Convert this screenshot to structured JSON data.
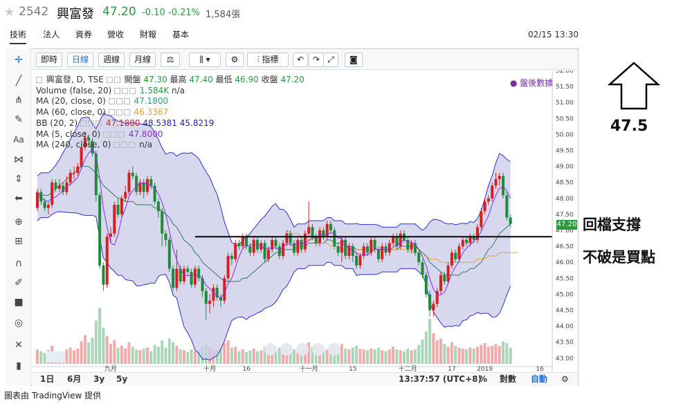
{
  "header": {
    "code": "2542",
    "name": "興富發",
    "price": "47.20",
    "change": "-0.10",
    "change_pct": "-0.21%",
    "volume": "1,584張",
    "datetime": "02/15 13:30"
  },
  "tabs": [
    {
      "label": "技術"
    },
    {
      "label": "法人"
    },
    {
      "label": "資券"
    },
    {
      "label": "營收"
    },
    {
      "label": "財報"
    },
    {
      "label": "基本"
    }
  ],
  "toolbar": {
    "intraday": "即時",
    "daily": "日線",
    "weekly": "週線",
    "monthly": "月線",
    "indicators": "指標"
  },
  "legend": {
    "main_title": "興富發, D, TSE",
    "open_label": "開盤",
    "open": "47.30",
    "high_label": "最高",
    "high": "47.40",
    "low_label": "最低",
    "low": "46.90",
    "close_label": "收盤",
    "close": "47.20",
    "volume": "Volume (false, 20)",
    "volume_val": "1.584K",
    "volume_na": "n/a",
    "ma20": "MA (20, close, 0)",
    "ma20_val": "47.1800",
    "ma60": "MA (60, close, 0)",
    "ma60_val": "46.3367",
    "bb": "BB (20, 2)",
    "bb_mid": "47.1800",
    "bb_up": "48.5381",
    "bb_low": "45.8219",
    "ma5": "MA (5, close, 0)",
    "ma5_val": "47.8000",
    "ma240": "MA (240, close, 0)",
    "ma240_val": "n/a",
    "after_hours": "盤後數據"
  },
  "bottom_bar": {
    "r1": "1日",
    "r2": "6月",
    "r3": "3y",
    "r4": "5y",
    "time": "13:37:57 (UTC+8)",
    "pct": "%",
    "log": "對數",
    "auto": "自動"
  },
  "footer": "圖表由 TradingView 提供",
  "annotations": {
    "target": "47.5",
    "support1": "回檔支撐",
    "support2": "不破是買點"
  },
  "chart_data": {
    "type": "candlestick",
    "yticks": [
      "52.00",
      "51.50",
      "51.00",
      "50.50",
      "50.00",
      "49.50",
      "49.00",
      "48.50",
      "48.00",
      "47.50",
      "47.00",
      "46.50",
      "46.00",
      "45.50",
      "45.00",
      "44.50",
      "44.00",
      "43.50",
      "43.00"
    ],
    "ylim": [
      43,
      52
    ],
    "xticks": [
      {
        "label": "九月",
        "i": 20
      },
      {
        "label": "十月",
        "i": 47
      },
      {
        "label": "16",
        "i": 57
      },
      {
        "label": "十一月",
        "i": 74
      },
      {
        "label": "15",
        "i": 86
      },
      {
        "label": "十二月",
        "i": 101
      },
      {
        "label": "17",
        "i": 113
      },
      {
        "label": "2019",
        "i": 122
      },
      {
        "label": "16",
        "i": 137
      },
      {
        "label": "二月",
        "i": 150
      }
    ],
    "last_price_label": "47.20",
    "support_line": 46.8,
    "candles": [
      [
        47.7,
        48.2,
        48.3,
        47.6
      ],
      [
        48.2,
        47.9,
        48.3,
        47.8
      ],
      [
        47.9,
        47.7,
        48.0,
        47.6
      ],
      [
        47.7,
        47.8,
        47.9,
        47.5
      ],
      [
        47.8,
        48.5,
        48.6,
        47.7
      ],
      [
        48.5,
        48.3,
        48.6,
        48.2
      ],
      [
        48.3,
        48.4,
        48.6,
        48.2
      ],
      [
        48.4,
        48.2,
        48.5,
        48.1
      ],
      [
        48.2,
        48.5,
        48.7,
        48.1
      ],
      [
        48.5,
        48.8,
        48.9,
        48.4
      ],
      [
        48.8,
        48.8,
        49.0,
        48.6
      ],
      [
        48.8,
        49.0,
        49.1,
        48.7
      ],
      [
        49.0,
        49.6,
        49.7,
        48.9
      ],
      [
        49.6,
        49.9,
        50.1,
        49.5
      ],
      [
        49.9,
        49.8,
        50.0,
        49.6
      ],
      [
        49.8,
        49.4,
        49.9,
        49.3
      ],
      [
        49.4,
        48.1,
        49.5,
        47.9
      ],
      [
        48.1,
        45.9,
        48.2,
        45.8
      ],
      [
        45.9,
        45.3,
        46.0,
        45.1
      ],
      [
        45.3,
        46.8,
        46.9,
        45.2
      ],
      [
        46.8,
        46.9,
        47.1,
        46.6
      ],
      [
        46.9,
        47.8,
        47.9,
        46.8
      ],
      [
        47.8,
        47.5,
        48.0,
        47.4
      ],
      [
        47.5,
        48.0,
        48.1,
        47.4
      ],
      [
        48.0,
        48.2,
        48.4,
        47.9
      ],
      [
        48.2,
        48.8,
        48.9,
        48.1
      ],
      [
        48.8,
        48.7,
        49.0,
        48.6
      ],
      [
        48.7,
        48.2,
        48.8,
        48.1
      ],
      [
        48.2,
        48.5,
        48.6,
        48.1
      ],
      [
        48.5,
        48.2,
        48.6,
        48.0
      ],
      [
        48.2,
        48.6,
        48.7,
        48.1
      ],
      [
        48.6,
        48.4,
        48.7,
        48.3
      ],
      [
        48.4,
        47.9,
        48.5,
        47.8
      ],
      [
        47.9,
        47.6,
        48.0,
        47.4
      ],
      [
        47.6,
        46.9,
        47.7,
        46.5
      ],
      [
        46.9,
        46.7,
        47.0,
        46.5
      ],
      [
        46.7,
        45.8,
        46.8,
        45.7
      ],
      [
        45.8,
        45.2,
        45.9,
        45.1
      ],
      [
        45.2,
        45.8,
        46.4,
        45.1
      ],
      [
        45.8,
        45.4,
        45.9,
        45.3
      ],
      [
        45.4,
        45.8,
        45.9,
        45.3
      ],
      [
        45.8,
        45.7,
        45.9,
        45.6
      ],
      [
        45.7,
        45.3,
        45.8,
        45.2
      ],
      [
        45.3,
        45.8,
        45.9,
        45.2
      ],
      [
        45.8,
        45.5,
        45.9,
        45.4
      ],
      [
        45.5,
        45.1,
        45.6,
        44.9
      ],
      [
        45.1,
        44.7,
        45.2,
        44.2
      ],
      [
        44.7,
        44.8,
        45.0,
        44.4
      ],
      [
        44.8,
        45.2,
        45.3,
        44.6
      ],
      [
        45.2,
        44.9,
        45.3,
        44.8
      ],
      [
        44.9,
        44.8,
        45.0,
        44.6
      ],
      [
        44.8,
        45.5,
        45.6,
        44.7
      ],
      [
        45.5,
        46.2,
        46.3,
        45.4
      ],
      [
        46.2,
        46.1,
        46.3,
        45.9
      ],
      [
        46.1,
        46.6,
        46.7,
        46.0
      ],
      [
        46.6,
        46.5,
        46.7,
        46.4
      ],
      [
        46.5,
        46.8,
        46.9,
        46.4
      ],
      [
        46.8,
        46.5,
        46.9,
        46.4
      ],
      [
        46.5,
        46.3,
        46.6,
        46.2
      ],
      [
        46.3,
        46.7,
        46.8,
        46.2
      ],
      [
        46.7,
        46.4,
        46.8,
        46.3
      ],
      [
        46.4,
        46.6,
        46.7,
        46.3
      ],
      [
        46.6,
        46.1,
        46.7,
        46.0
      ],
      [
        46.1,
        46.4,
        46.5,
        46.0
      ],
      [
        46.4,
        46.7,
        46.8,
        46.3
      ],
      [
        46.7,
        46.5,
        46.8,
        46.4
      ],
      [
        46.5,
        46.2,
        46.6,
        46.1
      ],
      [
        46.2,
        46.6,
        46.7,
        46.1
      ],
      [
        46.6,
        46.9,
        47.0,
        46.5
      ],
      [
        46.9,
        46.6,
        47.0,
        46.5
      ],
      [
        46.6,
        46.3,
        46.7,
        46.2
      ],
      [
        46.3,
        46.7,
        46.8,
        46.2
      ],
      [
        46.7,
        46.4,
        46.8,
        46.3
      ],
      [
        46.4,
        46.9,
        47.0,
        46.3
      ],
      [
        46.9,
        47.1,
        47.9,
        46.8
      ],
      [
        47.1,
        46.8,
        47.2,
        46.7
      ],
      [
        46.8,
        46.6,
        46.9,
        46.5
      ],
      [
        46.6,
        47.0,
        47.1,
        46.5
      ],
      [
        47.0,
        46.8,
        47.1,
        46.7
      ],
      [
        46.8,
        47.2,
        47.3,
        46.7
      ],
      [
        47.2,
        47.0,
        47.3,
        46.9
      ],
      [
        47.0,
        46.5,
        47.1,
        46.4
      ],
      [
        46.5,
        46.3,
        46.6,
        46.2
      ],
      [
        46.3,
        46.7,
        46.8,
        46.0
      ],
      [
        46.7,
        46.2,
        46.8,
        46.1
      ],
      [
        46.2,
        46.5,
        46.6,
        46.1
      ],
      [
        46.5,
        46.2,
        46.6,
        46.0
      ],
      [
        46.2,
        45.9,
        46.3,
        45.8
      ],
      [
        45.9,
        46.2,
        46.3,
        45.8
      ],
      [
        46.2,
        46.5,
        46.6,
        46.1
      ],
      [
        46.5,
        46.3,
        46.6,
        46.2
      ],
      [
        46.3,
        46.7,
        46.8,
        46.2
      ],
      [
        46.7,
        46.4,
        46.8,
        46.3
      ],
      [
        46.4,
        46.1,
        46.5,
        46.0
      ],
      [
        46.1,
        46.5,
        46.6,
        46.0
      ],
      [
        46.5,
        46.3,
        46.6,
        46.2
      ],
      [
        46.3,
        46.6,
        46.7,
        46.2
      ],
      [
        46.6,
        46.8,
        46.9,
        46.5
      ],
      [
        46.8,
        46.5,
        46.9,
        46.4
      ],
      [
        46.5,
        46.9,
        47.0,
        46.4
      ],
      [
        46.9,
        46.7,
        47.0,
        46.6
      ],
      [
        46.7,
        46.4,
        46.8,
        46.3
      ],
      [
        46.4,
        46.6,
        46.7,
        46.3
      ],
      [
        46.6,
        46.3,
        46.7,
        46.2
      ],
      [
        46.3,
        46.0,
        46.4,
        45.9
      ],
      [
        46.0,
        45.6,
        46.1,
        45.5
      ],
      [
        45.6,
        45.0,
        45.7,
        44.9
      ],
      [
        45.0,
        44.5,
        45.1,
        44.3
      ],
      [
        44.5,
        44.7,
        44.8,
        44.3
      ],
      [
        44.7,
        45.1,
        45.2,
        44.6
      ],
      [
        45.1,
        45.6,
        45.7,
        45.0
      ],
      [
        45.6,
        45.4,
        45.7,
        45.3
      ],
      [
        45.4,
        45.9,
        46.0,
        45.3
      ],
      [
        45.9,
        46.3,
        46.4,
        45.8
      ],
      [
        46.3,
        46.1,
        46.4,
        46.0
      ],
      [
        46.1,
        46.5,
        46.6,
        46.0
      ],
      [
        46.5,
        46.7,
        46.8,
        46.4
      ],
      [
        46.7,
        46.6,
        46.8,
        46.5
      ],
      [
        46.6,
        46.8,
        46.9,
        46.5
      ],
      [
        46.8,
        46.7,
        46.9,
        46.6
      ],
      [
        46.7,
        47.1,
        47.2,
        46.6
      ],
      [
        47.1,
        47.6,
        47.7,
        47.0
      ],
      [
        47.6,
        47.9,
        48.0,
        47.5
      ],
      [
        47.9,
        48.0,
        48.1,
        47.8
      ],
      [
        48.0,
        48.4,
        48.5,
        47.9
      ],
      [
        48.4,
        48.6,
        48.8,
        48.3
      ],
      [
        48.6,
        48.7,
        48.8,
        48.4
      ],
      [
        48.7,
        48.1,
        48.8,
        48.0
      ],
      [
        48.1,
        47.4,
        48.2,
        47.3
      ],
      [
        47.4,
        47.2,
        47.5,
        47.1
      ]
    ],
    "volume": [
      1.6,
      1.4,
      1.2,
      1.5,
      2.0,
      1.3,
      1.1,
      1.4,
      1.6,
      1.8,
      1.5,
      1.7,
      2.5,
      3.2,
      2.4,
      2.9,
      4.8,
      6.2,
      4.0,
      3.1,
      2.2,
      2.6,
      1.8,
      2.0,
      1.7,
      2.4,
      1.9,
      1.6,
      1.5,
      1.7,
      1.8,
      1.4,
      2.1,
      1.9,
      2.6,
      1.8,
      2.8,
      2.4,
      2.0,
      1.6,
      1.5,
      1.3,
      1.6,
      1.4,
      1.5,
      1.9,
      2.2,
      1.8,
      1.6,
      1.5,
      1.7,
      2.3,
      2.6,
      1.8,
      1.9,
      1.4,
      1.6,
      1.3,
      1.5,
      1.7,
      1.4,
      1.5,
      1.9,
      1.6,
      1.4,
      1.5,
      1.8,
      1.6,
      1.7,
      1.5,
      1.6,
      1.7,
      1.5,
      1.8,
      2.4,
      1.9,
      1.6,
      1.7,
      1.5,
      1.6,
      1.5,
      1.8,
      1.9,
      2.2,
      1.7,
      1.6,
      1.8,
      2.0,
      1.7,
      1.6,
      1.5,
      1.7,
      1.6,
      1.8,
      1.5,
      1.4,
      1.6,
      1.9,
      1.6,
      1.5,
      1.4,
      1.7,
      1.5,
      1.6,
      2.1,
      2.7,
      3.6,
      5.0,
      3.4,
      2.6,
      2.8,
      2.2,
      1.9,
      2.4,
      2.0,
      1.8,
      1.7,
      1.6,
      1.8,
      1.7,
      1.9,
      2.1,
      2.3,
      1.9,
      2.0,
      2.2,
      2.0,
      2.5,
      2.3,
      1.8
    ],
    "ma20": [
      48.0,
      48.1,
      48.1,
      48.1,
      48.2,
      48.3,
      48.4,
      48.5,
      48.6,
      48.7,
      48.8,
      48.9,
      49.0,
      49.0,
      49.0,
      48.9,
      48.8,
      48.6,
      48.4,
      48.3,
      48.2,
      48.1,
      48.0,
      48.0,
      47.9,
      47.9,
      47.9,
      47.8,
      47.8,
      47.8,
      47.8,
      47.8,
      47.7,
      47.7,
      47.6,
      47.5,
      47.4,
      47.2,
      47.1,
      46.9,
      46.7,
      46.6,
      46.5,
      46.3,
      46.2,
      46.0,
      45.9,
      45.8,
      45.7,
      45.6,
      45.5,
      45.4,
      45.4,
      45.4,
      45.4,
      45.4,
      45.5,
      45.5,
      45.6,
      45.7,
      45.8,
      45.9,
      46.0,
      46.1,
      46.2,
      46.3,
      46.3,
      46.4,
      46.4,
      46.4,
      46.4,
      46.5,
      46.5,
      46.5,
      46.6,
      46.6,
      46.6,
      46.6,
      46.6,
      46.7,
      46.7,
      46.6,
      46.6,
      46.6,
      46.5,
      46.5,
      46.5,
      46.4,
      46.4,
      46.4,
      46.4,
      46.4,
      46.4,
      46.4,
      46.4,
      46.4,
      46.4,
      46.4,
      46.4,
      46.5,
      46.5,
      46.5,
      46.5,
      46.5,
      46.4,
      46.3,
      46.2,
      46.0,
      45.9,
      45.8,
      45.7,
      45.6,
      45.6,
      45.6,
      45.6,
      45.6,
      45.7,
      45.7,
      45.8,
      45.8,
      45.9,
      46.0,
      46.2,
      46.4,
      46.5,
      46.7,
      46.9,
      47.0,
      47.1,
      47.2
    ],
    "ma60": [
      null,
      null,
      null,
      null,
      null,
      null,
      null,
      null,
      null,
      null,
      null,
      null,
      null,
      null,
      null,
      null,
      null,
      null,
      null,
      null,
      null,
      null,
      null,
      null,
      null,
      null,
      null,
      null,
      null,
      null,
      null,
      null,
      null,
      null,
      null,
      null,
      null,
      null,
      null,
      null,
      null,
      null,
      null,
      null,
      null,
      null,
      null,
      null,
      null,
      null,
      null,
      null,
      null,
      null,
      null,
      null,
      null,
      null,
      null,
      null,
      null,
      null,
      null,
      null,
      null,
      null,
      null,
      null,
      47.0,
      46.9,
      46.9,
      46.9,
      46.8,
      46.8,
      46.7,
      46.7,
      46.7,
      46.6,
      46.6,
      46.6,
      46.5,
      46.5,
      46.5,
      46.4,
      46.4,
      46.4,
      46.4,
      46.4,
      46.4,
      46.4,
      46.4,
      46.4,
      46.4,
      46.4,
      46.4,
      46.4,
      46.4,
      46.4,
      46.4,
      46.4,
      46.4,
      46.4,
      46.3,
      46.3,
      46.3,
      46.2,
      46.2,
      46.1,
      46.1,
      46.1,
      46.0,
      46.0,
      46.0,
      46.0,
      46.0,
      46.0,
      46.0,
      46.0,
      46.0,
      46.0,
      46.1,
      46.1,
      46.1,
      46.2,
      46.2,
      46.2,
      46.3,
      46.3,
      46.3,
      46.3,
      46.3,
      46.3
    ]
  }
}
